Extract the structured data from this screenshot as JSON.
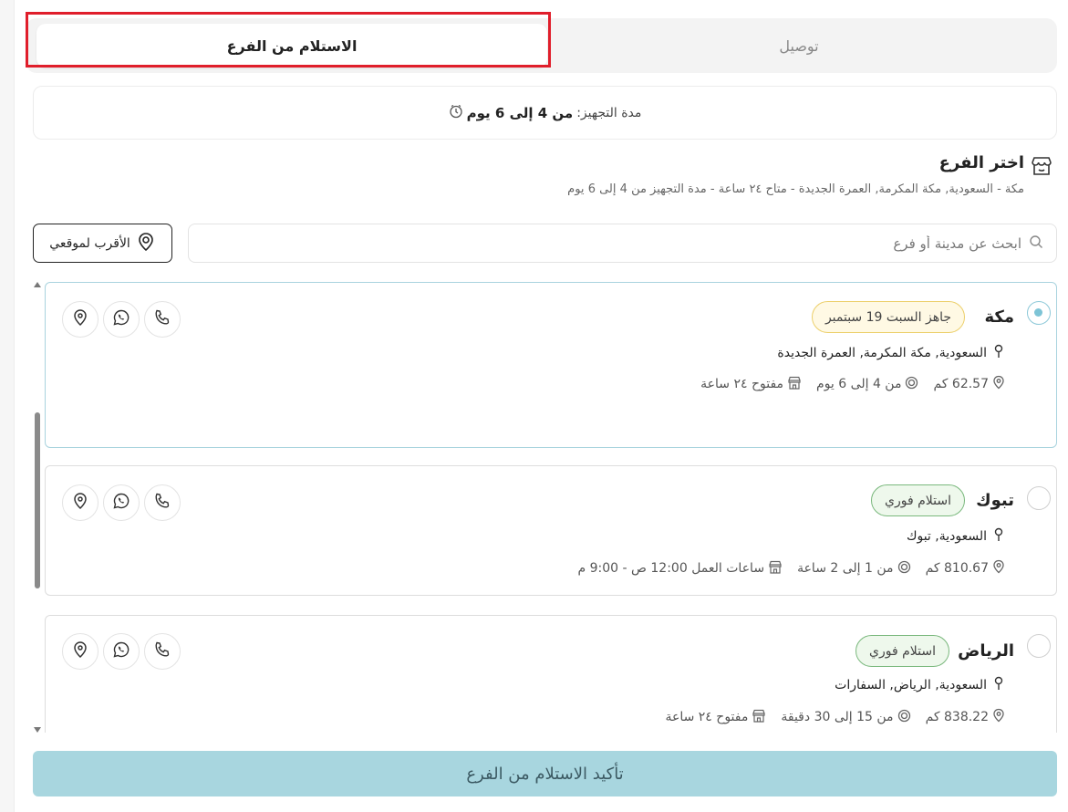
{
  "tabs": {
    "pickup": "الاستلام من الفرع",
    "delivery": "توصيل"
  },
  "prep": {
    "label": "مدة التجهيز:",
    "value": "من 4 إلى 6 يوم"
  },
  "section": {
    "title": "اختر الفرع",
    "subtitle": "مكة  -  السعودية, مكة المكرمة, العمرة الجديدة  -  متاح ٢٤ ساعة  -  مدة التجهيز من 4 إلى 6 يوم"
  },
  "nearest_button": "الأقرب لموقعي",
  "search": {
    "placeholder": "ابحث عن مدينة أو فرع"
  },
  "branches": [
    {
      "name": "مكة",
      "badge": "جاهز السبت 19 سبتمبر",
      "badge_type": "ready",
      "selected": true,
      "address": "السعودية, مكة المكرمة, العمرة الجديدة",
      "distance": "62.57 كم",
      "prep": "من 4 إلى 6 يوم",
      "hours": "مفتوح ٢٤ ساعة"
    },
    {
      "name": "تبوك",
      "badge": "استلام فوري",
      "badge_type": "instant",
      "selected": false,
      "address": "السعودية, تبوك",
      "distance": "810.67 كم",
      "prep": "من 1 إلى 2 ساعة",
      "hours": "ساعات العمل 12:00 ص - 9:00 م"
    },
    {
      "name": "الرياض",
      "badge": "استلام فوري",
      "badge_type": "instant",
      "selected": false,
      "address": "السعودية, الرياض, السفارات",
      "distance": "838.22 كم",
      "prep": "من 15 إلى 30 دقيقة",
      "hours": "مفتوح ٢٤ ساعة"
    }
  ],
  "icons": {
    "store": "store-icon",
    "clock": "clock-icon",
    "pin": "map-pin-icon",
    "phone": "phone-icon",
    "whatsapp": "whatsapp-icon",
    "location": "location-icon",
    "search": "search-icon",
    "target": "target-icon"
  },
  "confirm_button": "تأكيد الاستلام من الفرع",
  "colors": {
    "accent": "#a8d6df",
    "highlight": "#e01e2b",
    "ready_badge_border": "#eccf6a",
    "instant_badge_border": "#7ab87d"
  }
}
